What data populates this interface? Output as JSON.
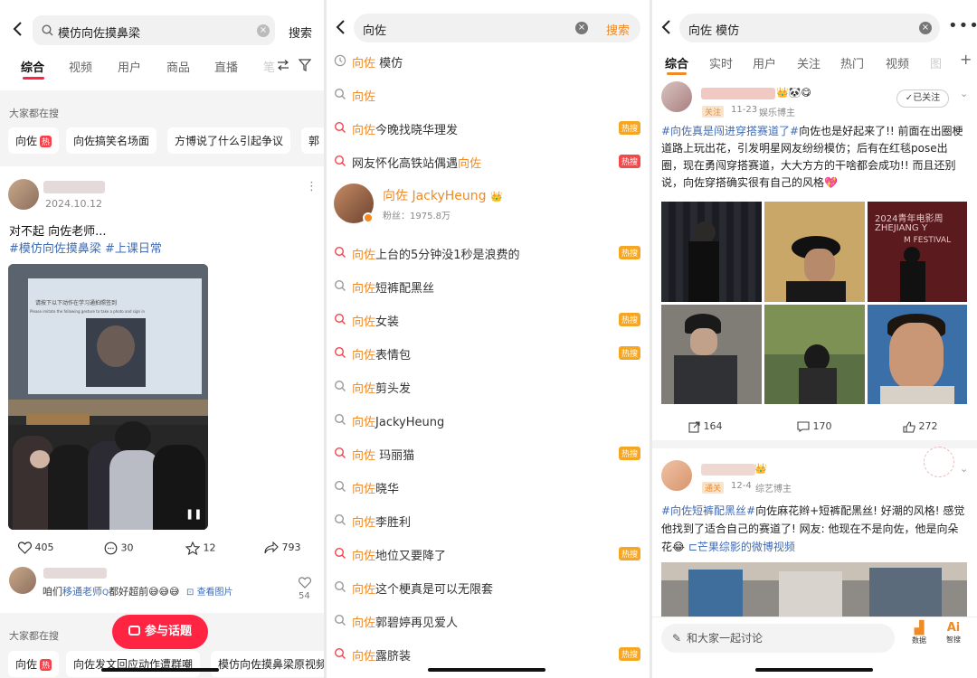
{
  "p1": {
    "search": {
      "query": "模仿向佐摸鼻梁",
      "button": "搜索"
    },
    "tabs": [
      "综合",
      "视频",
      "用户",
      "商品",
      "直播",
      "笔"
    ],
    "section_title": "大家都在搜",
    "chips": [
      {
        "label": "向佐",
        "badge": "热"
      },
      {
        "label": "向佐搞笑名场面"
      },
      {
        "label": "方博说了什么引起争议"
      },
      {
        "label": "郭"
      }
    ],
    "post": {
      "date": "2024.10.12",
      "text": "对不起 向佐老师...",
      "tags": "#模仿向佐摸鼻梁 #上课日常",
      "slide_line1": "请按下以下动作在学习通拍照签到",
      "slide_line2": "Please imitate the following gesture to take a photo and sign in",
      "stats": {
        "likes": "405",
        "comments": "30",
        "favorites": "12",
        "shares": "793"
      }
    },
    "comment": {
      "prefix": "咱们",
      "mention": "移通老师",
      "suffix": "都好超前",
      "emoji": "😅😅😅",
      "view_image": "查看图片",
      "likes": "54"
    },
    "section_title2": "大家都在搜",
    "chips2": [
      {
        "label": "向佐",
        "badge": "热"
      },
      {
        "label": "向佐发文回应动作遭群嘲"
      },
      {
        "label": "模仿向佐摸鼻梁原视频"
      }
    ],
    "topic_button": "参与话题"
  },
  "p2": {
    "search": {
      "query": "向佐",
      "button": "搜索"
    },
    "suggestions": [
      {
        "kind": "history",
        "pre": "",
        "hl": "向佐",
        "post": " 模仿",
        "badge": ""
      },
      {
        "kind": "search",
        "pre": "",
        "hl": "向佐",
        "post": "",
        "badge": ""
      },
      {
        "kind": "trend",
        "pre": "",
        "hl": "向佐",
        "post": "今晚找晓华理发",
        "badge": "热搜"
      },
      {
        "kind": "trend",
        "pre": "网友怀化高铁站偶遇",
        "hl": "向佐",
        "post": "",
        "badge": "热搜",
        "badge_red": true
      },
      {
        "kind": "user"
      },
      {
        "kind": "trend",
        "pre": "",
        "hl": "向佐",
        "post": "上台的5分钟没1秒是浪费的",
        "badge": "热搜"
      },
      {
        "kind": "search",
        "pre": "",
        "hl": "向佐",
        "post": "短裤配黑丝",
        "badge": ""
      },
      {
        "kind": "trend",
        "pre": "",
        "hl": "向佐",
        "post": "女装",
        "badge": "热搜"
      },
      {
        "kind": "trend",
        "pre": "",
        "hl": "向佐",
        "post": "表情包",
        "badge": "热搜"
      },
      {
        "kind": "search",
        "pre": "",
        "hl": "向佐",
        "post": "剪头发",
        "badge": ""
      },
      {
        "kind": "search",
        "pre": "",
        "hl": "向佐",
        "post": "JackyHeung",
        "badge": ""
      },
      {
        "kind": "trend",
        "pre": "",
        "hl": "向佐",
        "post": " 玛丽猫",
        "badge": "热搜"
      },
      {
        "kind": "search",
        "pre": "",
        "hl": "向佐",
        "post": "晓华",
        "badge": ""
      },
      {
        "kind": "search",
        "pre": "",
        "hl": "向佐",
        "post": "李胜利",
        "badge": ""
      },
      {
        "kind": "trend",
        "pre": "",
        "hl": "向佐",
        "post": "地位又要降了",
        "badge": "热搜"
      },
      {
        "kind": "search",
        "pre": "",
        "hl": "向佐",
        "post": "这个梗真是可以无限套",
        "badge": ""
      },
      {
        "kind": "search",
        "pre": "",
        "hl": "向佐",
        "post": "郭碧婷再见爱人",
        "badge": ""
      },
      {
        "kind": "trend",
        "pre": "",
        "hl": "向佐",
        "post": "露脐装",
        "badge": "热搜"
      }
    ],
    "user": {
      "name_hl": "向佐",
      "name_rest": " JackyHeung",
      "fans": "粉丝：1975.8万"
    }
  },
  "p3": {
    "search": {
      "query": "向佐 模仿"
    },
    "tabs": [
      "综合",
      "实时",
      "用户",
      "关注",
      "热门",
      "视频",
      "图"
    ],
    "post1": {
      "badge": "关注",
      "date": "11-23",
      "role": "娱乐博主",
      "follow": "已关注",
      "text_tag": "#向佐真是闯进穿搭赛道了#",
      "text_body": "向佐也是好起来了!! 前面在出圈梗道路上玩出花，引发明星网友纷纷模仿；后有在红毯pose出圈，现在勇闯穿搭赛道，大大方方的干啥都会成功!! 而且还别说，向佐穿搭确实很有自己的风格💖",
      "photo_text": "2024青年电影周",
      "photo_text2": "ZHEJIANG Y",
      "photo_text3": "M FESTIVAL",
      "stats": {
        "shares": "164",
        "comments": "170",
        "likes": "272"
      }
    },
    "post2": {
      "badge": "通关",
      "date": "12-4",
      "role": "综艺博主",
      "text_tag": "#向佐短裤配黑丝#",
      "text_body": "向佐麻花辫+短裤配黑丝! 好潮的风格! 感觉他找到了适合自己的赛道了! 网友: 他现在不是向佐，他是向朵花😂",
      "link": "芒果综影的微博视频"
    },
    "comment_placeholder": "和大家一起讨论",
    "bottom": [
      {
        "label": "数据"
      },
      {
        "label": "智搜"
      }
    ]
  },
  "colors": {
    "accent_orange": "#f08a24",
    "hot_red": "#f5424a",
    "topic_red": "#ff2442",
    "link_blue": "#3f6bb5"
  }
}
